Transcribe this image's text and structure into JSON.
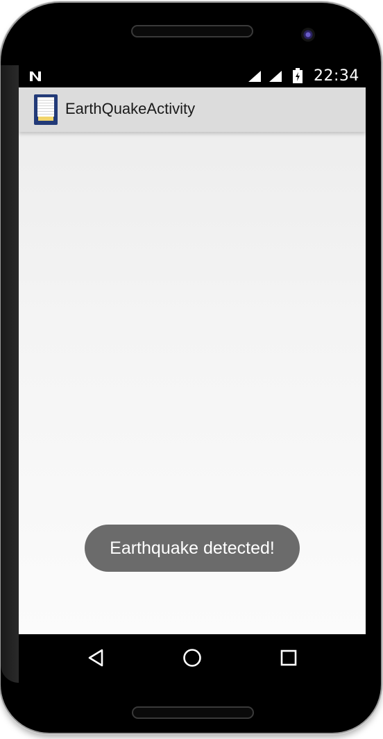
{
  "status_bar": {
    "time": "22:34",
    "icons": [
      "n-notification-icon",
      "signal-icon",
      "signal-icon",
      "battery-charging-icon"
    ]
  },
  "action_bar": {
    "title": "EarthQuakeActivity",
    "app_icon": "app-launcher-icon"
  },
  "toast": {
    "message": "Earthquake detected!"
  },
  "nav_bar": {
    "buttons": [
      "back-icon",
      "home-icon",
      "recents-icon"
    ]
  },
  "colors": {
    "action_bar": "#dcdcdc",
    "toast_bg": "#6b6b6b",
    "screen_top": "#ebebeb",
    "screen_bottom": "#fbfbfb"
  }
}
